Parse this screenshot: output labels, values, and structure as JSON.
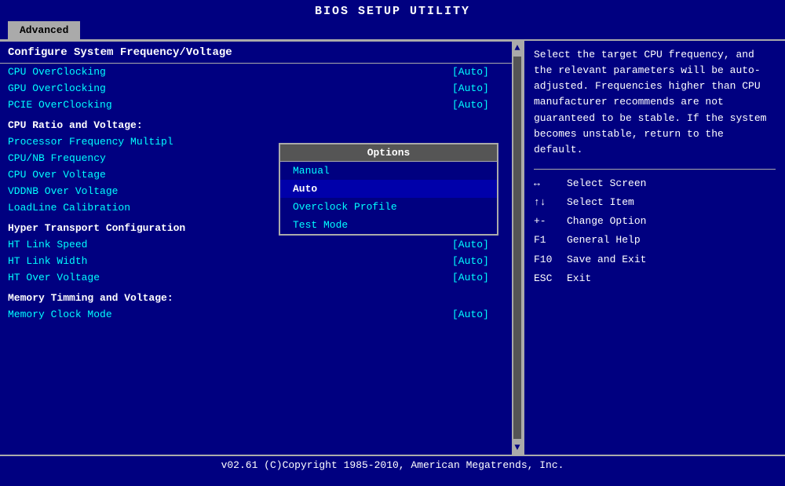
{
  "title": "BIOS SETUP UTILITY",
  "tabs": [
    {
      "label": "Advanced",
      "active": true
    }
  ],
  "left_panel": {
    "section_title": "Configure System Frequency/Voltage",
    "basic_settings": [
      {
        "label": "CPU OverClocking",
        "value": "[Auto]"
      },
      {
        "label": "GPU OverClocking",
        "value": "[Auto]"
      },
      {
        "label": "PCIE OverClocking",
        "value": "[Auto]"
      }
    ],
    "cpu_section_title": "CPU Ratio and Voltage:",
    "cpu_settings": [
      {
        "label": "Processor Frequency Multipl",
        "value": ""
      },
      {
        "label": "CPU/NB Frequency",
        "value": ""
      },
      {
        "label": "CPU Over Voltage",
        "value": ""
      },
      {
        "label": "VDDNB Over Voltage",
        "value": ""
      },
      {
        "label": "LoadLine Calibration",
        "value": ""
      }
    ],
    "ht_section_title": "Hyper Transport Configuration",
    "ht_settings": [
      {
        "label": "HT Link Speed",
        "value": "[Auto]"
      },
      {
        "label": "HT Link Width",
        "value": "[Auto]"
      },
      {
        "label": "HT Over Voltage",
        "value": "[Auto]"
      }
    ],
    "mem_section_title": "Memory Timming and Voltage:",
    "mem_settings": [
      {
        "label": "Memory Clock Mode",
        "value": "[Auto]"
      }
    ],
    "dropdown": {
      "title": "Options",
      "items": [
        {
          "label": "Manual",
          "selected": false
        },
        {
          "label": "Auto",
          "selected": true
        },
        {
          "label": "Overclock Profile",
          "selected": false
        },
        {
          "label": "Test Mode",
          "selected": false
        }
      ]
    }
  },
  "right_panel": {
    "hint": "Select the target CPU frequency, and the relevant parameters will be auto-adjusted. Frequencies higher than CPU manufacturer recommends are not guaranteed to be stable. If the system becomes unstable, return to the default.",
    "keys": [
      {
        "sym": "↔",
        "desc": "Select Screen"
      },
      {
        "sym": "↑↓",
        "desc": "Select Item"
      },
      {
        "sym": "+-",
        "desc": "Change Option"
      },
      {
        "sym": "F1",
        "desc": "General Help"
      },
      {
        "sym": "F10",
        "desc": "Save and Exit"
      },
      {
        "sym": "ESC",
        "desc": "Exit"
      }
    ]
  },
  "footer": "v02.61  (C)Copyright 1985-2010, American Megatrends, Inc."
}
